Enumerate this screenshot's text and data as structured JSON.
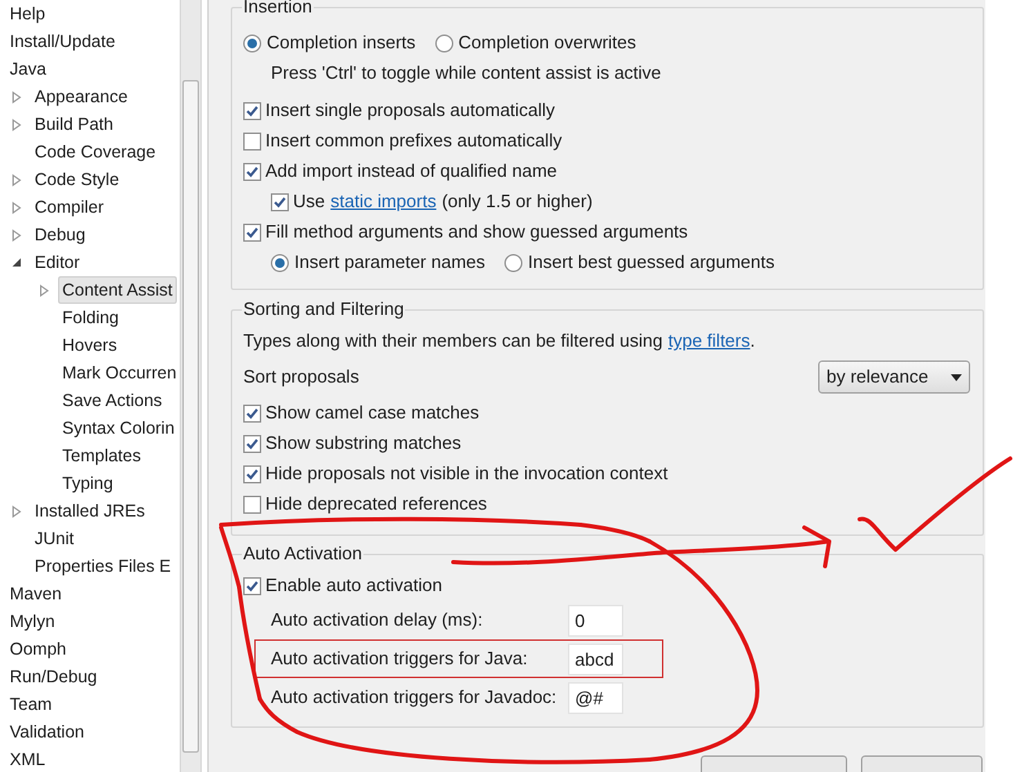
{
  "tree": [
    {
      "label": "Help",
      "selected": false
    },
    {
      "label": "Install/Update",
      "selected": false
    },
    {
      "label": "Java",
      "selected": false,
      "children": [
        {
          "label": "Appearance",
          "selected": false,
          "expanded": false
        },
        {
          "label": "Build Path",
          "selected": false,
          "expanded": false
        },
        {
          "label": "Code Coverage",
          "selected": false
        },
        {
          "label": "Code Style",
          "selected": false,
          "expanded": false
        },
        {
          "label": "Compiler",
          "selected": false,
          "expanded": false
        },
        {
          "label": "Debug",
          "selected": false,
          "expanded": false
        },
        {
          "label": "Editor",
          "selected": false,
          "expanded": true,
          "children": [
            {
              "label": "Content Assist",
              "selected": true,
              "expanded": false
            },
            {
              "label": "Folding",
              "selected": false
            },
            {
              "label": "Hovers",
              "selected": false
            },
            {
              "label": "Mark Occurren",
              "selected": false
            },
            {
              "label": "Save Actions",
              "selected": false
            },
            {
              "label": "Syntax Colorin",
              "selected": false
            },
            {
              "label": "Templates",
              "selected": false
            },
            {
              "label": "Typing",
              "selected": false
            }
          ]
        },
        {
          "label": "Installed JREs",
          "selected": false,
          "expanded": false
        },
        {
          "label": "JUnit",
          "selected": false
        },
        {
          "label": "Properties Files E",
          "selected": false
        }
      ]
    },
    {
      "label": "Maven",
      "selected": false
    },
    {
      "label": "Mylyn",
      "selected": false
    },
    {
      "label": "Oomph",
      "selected": false
    },
    {
      "label": "Run/Debug",
      "selected": false
    },
    {
      "label": "Team",
      "selected": false
    },
    {
      "label": "Validation",
      "selected": false
    },
    {
      "label": "XML",
      "selected": false
    }
  ],
  "insertion": {
    "title": "Insertion",
    "items": [
      {
        "kind": "radios",
        "options": [
          {
            "label": "Completion inserts",
            "selected": true
          },
          {
            "label": "Completion overwrites",
            "selected": false
          }
        ]
      },
      {
        "kind": "note",
        "text": "Press 'Ctrl' to toggle while content assist is active"
      },
      {
        "kind": "checkbox",
        "label": "Insert single proposals automatically",
        "checked": true
      },
      {
        "kind": "checkbox",
        "label": "Insert common prefixes automatically",
        "checked": false
      },
      {
        "kind": "checkbox",
        "label": "Add import instead of qualified name",
        "checked": true,
        "children": [
          {
            "kind": "linkcheckbox",
            "before": "Use",
            "link": "static imports",
            "after": "(only 1.5 or higher)",
            "checked": true
          }
        ]
      },
      {
        "kind": "checkbox",
        "label": "Fill method arguments and show guessed arguments",
        "checked": true,
        "children": [
          {
            "kind": "radios",
            "options": [
              {
                "label": "Insert parameter names",
                "selected": true
              },
              {
                "label": "Insert best guessed arguments",
                "selected": false
              }
            ]
          }
        ]
      }
    ]
  },
  "sorting": {
    "title": "Sorting and Filtering",
    "description": {
      "before": "Types along with their members can be filtered using",
      "link": "type filters",
      "after": "."
    },
    "sort": {
      "label": "Sort proposals",
      "value": "by relevance"
    },
    "checkboxes": [
      {
        "label": "Show camel case matches",
        "checked": true
      },
      {
        "label": "Show substring matches",
        "checked": true
      },
      {
        "label": "Hide proposals not visible in the invocation context",
        "checked": true
      },
      {
        "label": "Hide deprecated references",
        "checked": false
      }
    ]
  },
  "auto_activation": {
    "title": "Auto Activation",
    "enable": {
      "label": "Enable auto activation",
      "checked": true
    },
    "fields": [
      {
        "label": "Auto activation delay (ms):",
        "value": "0"
      },
      {
        "label": "Auto activation triggers for Java:",
        "value": "abcd",
        "annotated": true
      },
      {
        "label": "Auto activation triggers for Javadoc:",
        "value": "@#"
      }
    ]
  }
}
